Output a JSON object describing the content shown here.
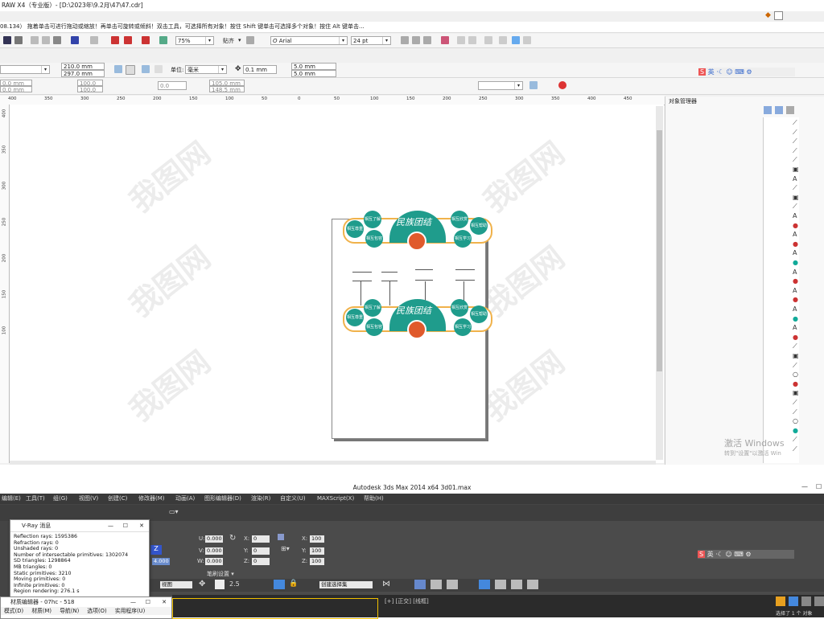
{
  "corel": {
    "title": "RAW X4（专业版）- [D:\\2023年\\9.2月\\47\\47.cdr]",
    "hint": "08.134）  拖着单击可进行拖动或缩放！再单击可旋转或倾斜！双击工具，可选择所有对象！按住 Shift 键单击可选择多个对象！按住 Alt 键单击...",
    "zoom": "75%",
    "snap_label": "贴齐",
    "font_name": "Arial",
    "font_size": "24 pt",
    "width": "210.0 mm",
    "height": "297.0 mm",
    "unit_label": "单位:",
    "unit": "毫米",
    "nudge": "0.1 mm",
    "dup_x": "5.0 mm",
    "dup_y": "5.0 mm",
    "pos_x": "0.0 mm",
    "pos_y": "0.0 mm",
    "scale_x": "100.0",
    "scale_y": "100.0",
    "rotation": "0.0",
    "center_x": "105.0 mm",
    "center_y": "148.5 mm",
    "outline": "0.0",
    "ime": "英",
    "ruler_ticks": [
      "400",
      "350",
      "300",
      "250",
      "200",
      "150",
      "100",
      "50",
      "0",
      "50",
      "100",
      "150",
      "200",
      "250",
      "300",
      "350",
      "400",
      "450"
    ],
    "vruler_ticks": [
      "400",
      "350",
      "300",
      "250",
      "200",
      "150",
      "100"
    ],
    "object_manager_title": "对象管理器",
    "activate_line1": "激活 Windows",
    "activate_line2": "转到\"设置\"以激活 Win"
  },
  "design": {
    "title": "民族团结",
    "left_circles": [
      "相互了解",
      "相互尊重",
      "相互包容"
    ],
    "right_circles": [
      "相互欣赏",
      "相互帮助",
      "相互学习"
    ],
    "left_circles_2": [
      "相互了解",
      "相互尊重",
      "相互包容"
    ],
    "right_circles_2": [
      "相互欣赏",
      "相互帮助",
      "相互学习"
    ]
  },
  "watermark": "我图网",
  "max": {
    "title": "Autodesk 3ds Max  2014 x64       3d01.max",
    "menu": [
      "编辑(E)",
      "工具(T)",
      "组(G)",
      "视图(V)",
      "创建(C)",
      "修改器(M)",
      "动画(A)",
      "图形编辑器(D)",
      "渲染(R)",
      "自定义(U)",
      "MAXScript(X)",
      "帮助(H)"
    ],
    "ui_label": "U:",
    "ui_val": "0.000",
    "vi_label": "V:",
    "vi_val": "0.000",
    "wi_label": "W:",
    "wi_val": "0.000",
    "x_label": "X:",
    "x_val": "0",
    "y_label": "Y:",
    "y_val": "0",
    "z_label": "Z:",
    "z_val": "0",
    "xs_val": "100",
    "ys_val": "100",
    "zs_val": "100",
    "view_label": "视图",
    "snap_num": "2.5",
    "selset": "创建选择集",
    "brush_label": "笔刷设置",
    "spinner": "4.000",
    "viewport": "[+] [正交] [线框]",
    "ime": "英"
  },
  "vray": {
    "title": "V-Ray 消息",
    "lines": [
      "Reflection rays: 1595386",
      "Refraction rays: 0",
      "Unshaded rays: 0",
      "Number of intersectable primitives: 1302074",
      "SD triangles: 1298864",
      "MB triangles: 0",
      "Static primitives: 3210",
      "Moving primitives: 0",
      "Infinite primitives: 0",
      "Region rendering: 276.1 s"
    ]
  },
  "material_editor": {
    "title": "材质编辑器 - 07hc - 518",
    "menu": [
      "模式(D)",
      "材质(M)",
      "导航(N)",
      "选项(O)",
      "实用程序(U)"
    ]
  },
  "right_status": "选择了 1 个 对象"
}
